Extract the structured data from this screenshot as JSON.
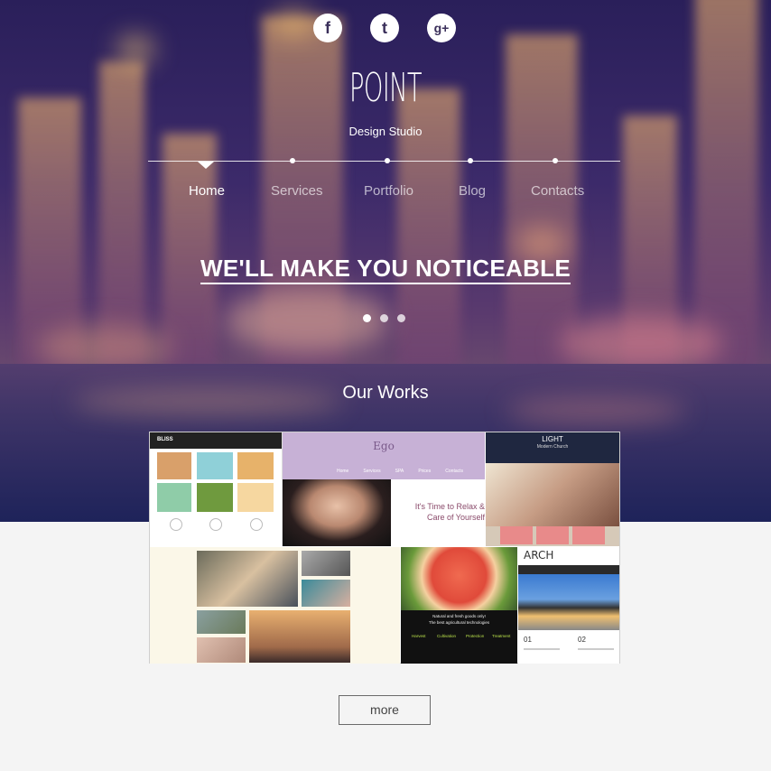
{
  "social": [
    {
      "name": "facebook-icon",
      "glyph": "f"
    },
    {
      "name": "tumblr-icon",
      "glyph": "t"
    },
    {
      "name": "google-plus-icon",
      "glyph": "g+"
    }
  ],
  "brand": {
    "logo": "POINT",
    "tagline": "Design Studio"
  },
  "nav": {
    "items": [
      "Home",
      "Services",
      "Portfolio",
      "Blog",
      "Contacts"
    ],
    "active": "Home"
  },
  "hero": {
    "headline": "WE'LL MAKE YOU NOTICEABLE",
    "slides": 3,
    "active_slide": 0
  },
  "works": {
    "title": "Our Works",
    "tiles": [
      {
        "name": "bliss-thumbnail",
        "title": "BLISS"
      },
      {
        "name": "ego-thumbnail",
        "title": "Ego",
        "menu": [
          "Home",
          "Services",
          "SPA",
          "Prices",
          "Contacts"
        ],
        "text_line1": "It's Time to Relax &",
        "text_line2": "Care of Yourself"
      },
      {
        "name": "light-thumbnail",
        "title": "LIGHT",
        "subtitle": "Modern Church"
      },
      {
        "name": "photo-collage-thumbnail"
      },
      {
        "name": "garden-fresh-thumbnail",
        "text_line1": "Natural and fresh goods only!",
        "text_line2": "The best agricultural technologies",
        "cols": [
          "Harvest",
          "Cultivation",
          "Protection",
          "Treatment"
        ]
      },
      {
        "name": "arch-thumbnail",
        "title": "ARCH",
        "nums": [
          "01",
          "02"
        ]
      }
    ]
  },
  "more_label": "more",
  "colors": {
    "hero_top": "#2a1f5a",
    "page_bg": "#f4f4f4",
    "button_border": "#6a6a6a"
  }
}
